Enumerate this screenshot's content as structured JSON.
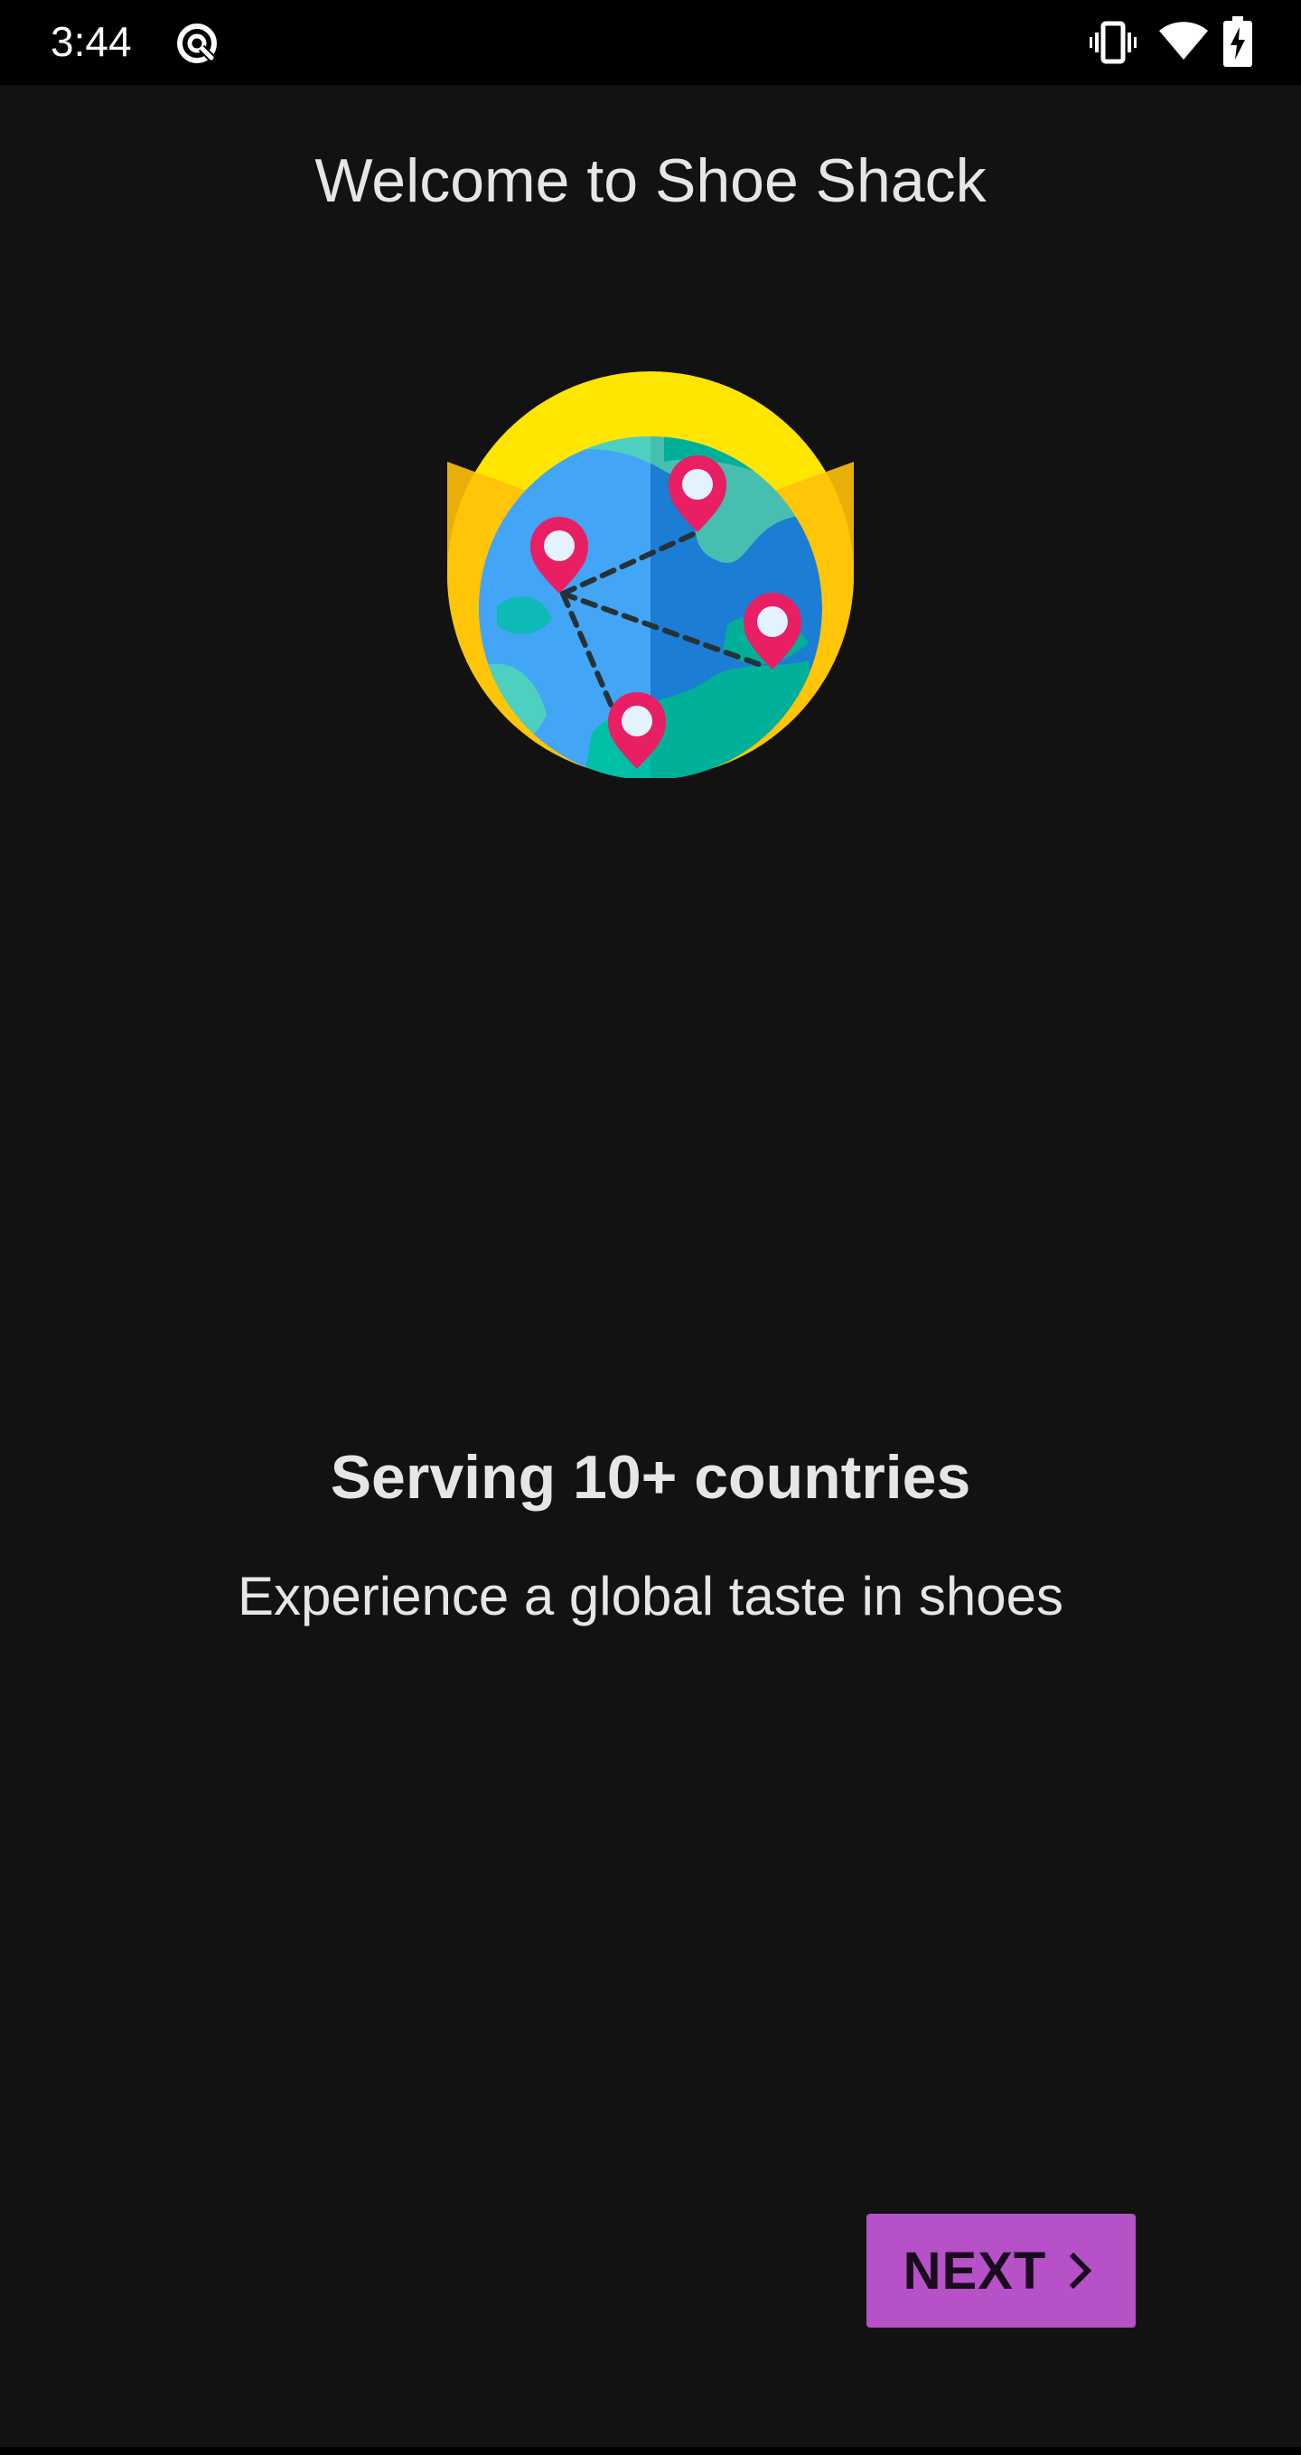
{
  "status_bar": {
    "time": "3:44",
    "icons": [
      "data-saver-icon",
      "vibrate-icon",
      "wifi-icon",
      "battery-charging-icon"
    ]
  },
  "onboarding": {
    "title": "Welcome to Shoe Shack",
    "illustration": "globe-with-map-pins-icon",
    "headline": "Serving 10+ countries",
    "subtitle": "Experience a global taste in shoes",
    "next_label": "NEXT",
    "next_icon": "chevron-right-icon"
  },
  "colors": {
    "background": "#121212",
    "status_bar": "#000000",
    "text": "#e6e6e6",
    "accent_button": "#b651c8",
    "globe_sun": "#ffe600",
    "globe_ocean": "#1e88e5",
    "globe_land": "#00bfa5",
    "pin": "#e91e63"
  }
}
